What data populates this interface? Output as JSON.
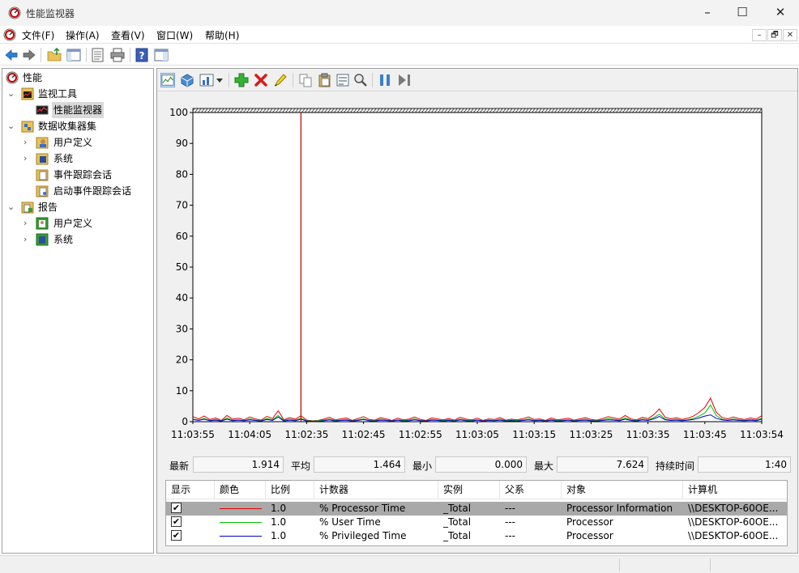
{
  "window": {
    "title": "性能监视器",
    "minimize_glyph": "–",
    "maximize_glyph": "☐",
    "close_glyph": "✕"
  },
  "menu": {
    "items": [
      "文件(F)",
      "操作(A)",
      "查看(V)",
      "窗口(W)",
      "帮助(H)"
    ],
    "mdi_minimize": "–",
    "mdi_restore": "🗗",
    "mdi_close": "✕"
  },
  "toolbar": {
    "icons": [
      "back-icon",
      "forward-icon",
      "up-folder-icon",
      "show-hide-tree-icon",
      "export-list-icon",
      "print-icon",
      "help-icon",
      "show-action-pane-icon"
    ]
  },
  "tree": {
    "items": [
      {
        "label": "性能",
        "level": 0,
        "expanded": null,
        "icon": "perf-icon"
      },
      {
        "label": "监视工具",
        "level": 1,
        "expanded": true,
        "icon": "monitor-tools-icon"
      },
      {
        "label": "性能监视器",
        "level": 2,
        "expanded": null,
        "icon": "perf-monitor-icon",
        "selected": true
      },
      {
        "label": "数据收集器集",
        "level": 1,
        "expanded": true,
        "icon": "data-collector-icon"
      },
      {
        "label": "用户定义",
        "level": 2,
        "expanded": false,
        "icon": "user-defined-icon"
      },
      {
        "label": "系统",
        "level": 2,
        "expanded": false,
        "icon": "system-icon"
      },
      {
        "label": "事件跟踪会话",
        "level": 2,
        "expanded": null,
        "icon": "event-trace-icon"
      },
      {
        "label": "启动事件跟踪会话",
        "level": 2,
        "expanded": null,
        "icon": "startup-trace-icon"
      },
      {
        "label": "报告",
        "level": 1,
        "expanded": true,
        "icon": "reports-icon"
      },
      {
        "label": "用户定义",
        "level": 2,
        "expanded": false,
        "icon": "report-user-icon"
      },
      {
        "label": "系统",
        "level": 2,
        "expanded": false,
        "icon": "report-system-icon"
      }
    ]
  },
  "graph_toolbar": {
    "icons": [
      "view-graph-icon",
      "view-current-activity-icon",
      "change-graph-type-icon",
      "dropdown-arrow-icon",
      "add-counter-icon",
      "delete-counter-icon",
      "highlight-icon",
      "copy-properties-icon",
      "paste-counter-list-icon",
      "properties-icon",
      "zoom-icon",
      "freeze-display-icon",
      "update-data-icon"
    ]
  },
  "chart_data": {
    "type": "line",
    "ylim": [
      0,
      100
    ],
    "y_ticks": [
      0,
      10,
      20,
      30,
      40,
      50,
      60,
      70,
      80,
      90,
      100
    ],
    "x_tick_labels": [
      "11:03:55",
      "11:04:05",
      "11:02:35",
      "11:02:45",
      "11:02:55",
      "11:03:05",
      "11:03:15",
      "11:03:25",
      "11:03:35",
      "11:03:45",
      "11:03:54"
    ],
    "x_range_seconds": 100,
    "current_time_marker_seconds": 19,
    "grid": false,
    "series": [
      {
        "color": "#e60000",
        "values": [
          1.6,
          0.9,
          1.8,
          0.7,
          1.2,
          0.4,
          2.0,
          0.8,
          1.1,
          0.6,
          1.5,
          0.9,
          0.5,
          1.7,
          1.0,
          3.5,
          0.6,
          1.3,
          0.8,
          1.9,
          0.5,
          0.3,
          0.4,
          0.8,
          1.4,
          0.6,
          0.9,
          1.2,
          0.4,
          1.0,
          1.6,
          0.7,
          0.5,
          1.3,
          0.9,
          0.4,
          1.1,
          0.6,
          0.8,
          1.5,
          0.7,
          0.4,
          1.2,
          0.9,
          0.6,
          1.0,
          0.5,
          1.4,
          0.8,
          0.6,
          1.1,
          0.4,
          0.9,
          0.7,
          1.3,
          0.5,
          0.8,
          0.6,
          1.0,
          1.5,
          0.7,
          0.9,
          0.4,
          1.2,
          0.6,
          0.8,
          1.1,
          0.5,
          0.9,
          1.3,
          0.7,
          0.5,
          1.0,
          1.6,
          1.2,
          0.8,
          2.0,
          0.9,
          0.6,
          1.4,
          1.0,
          2.2,
          4.1,
          1.5,
          0.9,
          1.3,
          0.7,
          1.1,
          1.8,
          3.0,
          4.6,
          7.6,
          3.1,
          1.4,
          0.9,
          1.5,
          1.0,
          0.7,
          1.2,
          0.8,
          1.9
        ]
      },
      {
        "color": "#00c000",
        "values": [
          0.8,
          0.5,
          1.0,
          0.4,
          0.7,
          0.2,
          1.2,
          0.5,
          0.6,
          0.3,
          0.9,
          0.5,
          0.3,
          1.0,
          0.6,
          2.0,
          0.4,
          0.8,
          0.5,
          1.1,
          0.3,
          0.2,
          0.3,
          0.5,
          0.8,
          0.4,
          0.5,
          0.7,
          0.2,
          0.6,
          0.9,
          0.4,
          0.3,
          0.8,
          0.5,
          0.2,
          0.6,
          0.4,
          0.5,
          0.9,
          0.4,
          0.2,
          0.7,
          0.5,
          0.4,
          0.6,
          0.3,
          0.8,
          0.5,
          0.4,
          0.6,
          0.2,
          0.5,
          0.4,
          0.8,
          0.3,
          0.5,
          0.4,
          0.6,
          0.9,
          0.4,
          0.5,
          0.2,
          0.7,
          0.4,
          0.5,
          0.6,
          0.3,
          0.5,
          0.8,
          0.4,
          0.3,
          0.6,
          1.0,
          0.7,
          0.5,
          1.2,
          0.5,
          0.4,
          0.8,
          0.6,
          1.3,
          2.4,
          0.9,
          0.5,
          0.8,
          0.4,
          0.6,
          1.1,
          1.8,
          2.8,
          5.4,
          2.0,
          0.8,
          0.5,
          0.9,
          0.6,
          0.4,
          0.7,
          0.5,
          1.1
        ]
      },
      {
        "color": "#0000d0",
        "values": [
          0.7,
          0.4,
          0.8,
          0.3,
          0.5,
          0.2,
          0.8,
          0.3,
          0.5,
          0.3,
          0.6,
          0.4,
          0.2,
          0.7,
          0.4,
          1.5,
          0.2,
          0.5,
          0.3,
          0.8,
          0.2,
          0.1,
          0.1,
          0.3,
          0.6,
          0.2,
          0.4,
          0.5,
          0.2,
          0.4,
          0.7,
          0.3,
          0.2,
          0.5,
          0.4,
          0.2,
          0.5,
          0.2,
          0.3,
          0.6,
          0.3,
          0.2,
          0.5,
          0.4,
          0.2,
          0.4,
          0.2,
          0.6,
          0.3,
          0.2,
          0.5,
          0.2,
          0.4,
          0.3,
          0.5,
          0.2,
          0.3,
          0.2,
          0.4,
          0.6,
          0.3,
          0.4,
          0.2,
          0.5,
          0.2,
          0.3,
          0.5,
          0.2,
          0.4,
          0.5,
          0.3,
          0.2,
          0.4,
          0.6,
          0.5,
          0.3,
          0.8,
          0.4,
          0.2,
          0.6,
          0.4,
          0.9,
          1.7,
          0.6,
          0.4,
          0.5,
          0.3,
          0.5,
          0.7,
          1.2,
          1.8,
          2.2,
          1.1,
          0.6,
          0.4,
          0.6,
          0.4,
          0.3,
          0.5,
          0.3,
          0.8
        ]
      }
    ]
  },
  "stats": {
    "last_label": "最新",
    "last_value": "1.914",
    "avg_label": "平均",
    "avg_value": "1.464",
    "min_label": "最小",
    "min_value": "0.000",
    "max_label": "最大",
    "max_value": "7.624",
    "duration_label": "持续时间",
    "duration_value": "1:40"
  },
  "counter_table": {
    "headers": [
      "显示",
      "颜色",
      "比例",
      "计数器",
      "实例",
      "父系",
      "对象",
      "计算机"
    ],
    "rows": [
      {
        "show": "✔",
        "color": "#e60000",
        "scale": "1.0",
        "counter": "% Processor Time",
        "instance": "_Total",
        "parent": "---",
        "object": "Processor Information",
        "computer": "\\\\DESKTOP-60OE...",
        "selected": true
      },
      {
        "show": "✔",
        "color": "#00c000",
        "scale": "1.0",
        "counter": "% User Time",
        "instance": "_Total",
        "parent": "---",
        "object": "Processor",
        "computer": "\\\\DESKTOP-60OE...",
        "selected": false
      },
      {
        "show": "✔",
        "color": "#0000d0",
        "scale": "1.0",
        "counter": "% Privileged Time",
        "instance": "_Total",
        "parent": "---",
        "object": "Processor",
        "computer": "\\\\DESKTOP-60OE...",
        "selected": false
      }
    ]
  }
}
